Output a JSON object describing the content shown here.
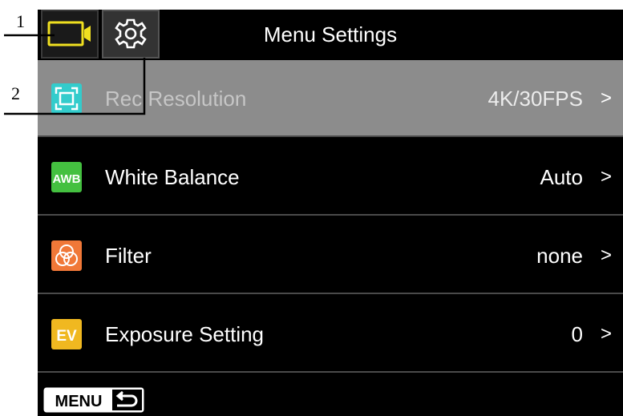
{
  "callouts": [
    {
      "number": "1"
    },
    {
      "number": "2"
    }
  ],
  "header": {
    "title": "Menu Settings",
    "tabs": [
      {
        "name": "video-mode",
        "icon": "video-camera-icon",
        "active": true
      },
      {
        "name": "settings",
        "icon": "gear-icon",
        "active": false
      }
    ]
  },
  "menu": {
    "items": [
      {
        "label": "Rec Resolution",
        "value": "4K/30FPS",
        "icon": "resolution-icon",
        "icon_color": "#33cccc",
        "selected": true
      },
      {
        "label": "White Balance",
        "value": "Auto",
        "icon": "awb-icon",
        "icon_text": "AWB",
        "icon_color": "#44c040",
        "selected": false
      },
      {
        "label": "Filter",
        "value": "none",
        "icon": "filter-icon",
        "icon_color": "#f07838",
        "selected": false
      },
      {
        "label": "Exposure Setting",
        "value": "0",
        "icon": "ev-icon",
        "icon_text": "EV",
        "icon_color": "#f0b820",
        "selected": false
      }
    ],
    "chevron": ">"
  },
  "footer": {
    "menu_button_label": "MENU",
    "back_icon": "back-arrow-icon"
  },
  "colors": {
    "background": "#000000",
    "selected_row": "#8c8c8c",
    "video_icon": "#f0e020",
    "divider": "#4a4a4a"
  }
}
